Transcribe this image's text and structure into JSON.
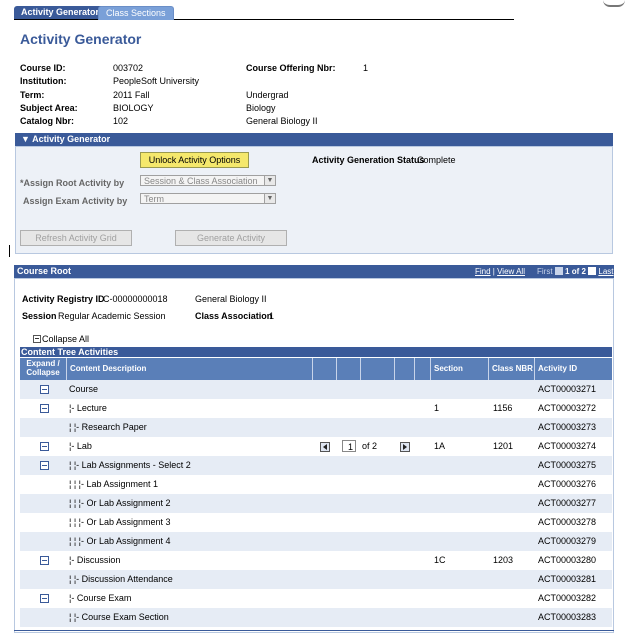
{
  "tabs": [
    {
      "label": "Activity Generator",
      "active": true
    },
    {
      "label": "Class Sections",
      "active": false
    }
  ],
  "page_title": "Activity Generator",
  "course_info": {
    "course_id_label": "Course ID:",
    "course_id": "003702",
    "offering_label": "Course Offering Nbr:",
    "offering": "1",
    "institution_label": "Institution:",
    "institution": "PeopleSoft University",
    "term_label": "Term:",
    "term": "2011 Fall",
    "career": "Undergrad",
    "subject_label": "Subject Area:",
    "subject": "BIOLOGY",
    "subject_desc": "Biology",
    "catalog_label": "Catalog Nbr:",
    "catalog": "102",
    "catalog_desc": "General Biology II"
  },
  "activity_generator": {
    "header": "▼ Activity Generator",
    "unlock_button": "Unlock Activity Options",
    "status_label": "Activity Generation Status",
    "status_value": "Complete",
    "assign_root_label": "*Assign Root Activity by",
    "assign_root_value": "Session & Class Association",
    "assign_exam_label": "Assign Exam Activity by",
    "assign_exam_value": "Term",
    "refresh_button": "Refresh Activity Grid",
    "generate_button": "Generate Activity"
  },
  "course_root": {
    "header": "Course Root",
    "find": "Find",
    "sep": "|",
    "view_all": "View All",
    "first": "First",
    "count": "1 of 2",
    "last": "Last",
    "registry_label": "Activity Registry ID",
    "registry_id": "C-00000000018",
    "registry_desc": "General Biology II",
    "session_label": "Session",
    "session_value": "Regular Academic Session",
    "class_assoc_label": "Class Association",
    "class_assoc_value": "1",
    "collapse_all": "Collapse All"
  },
  "grid": {
    "title": "Content Tree Activities",
    "columns": {
      "expand": "Expand / Collapse",
      "desc": "Content Description",
      "section": "Section",
      "class_nbr": "Class NBR",
      "activity_id": "Activity ID"
    },
    "rows": [
      {
        "minus": true,
        "desc": "Course",
        "section": "",
        "class_nbr": "",
        "activity_id": "ACT00003271"
      },
      {
        "minus": true,
        "desc": "¦- Lecture",
        "section": "1",
        "class_nbr": "1156",
        "activity_id": "ACT00003272"
      },
      {
        "minus": false,
        "desc": "¦ ¦- Research Paper",
        "section": "",
        "class_nbr": "",
        "activity_id": "ACT00003273"
      },
      {
        "minus": true,
        "desc": "¦- Lab",
        "section": "1A",
        "class_nbr": "1201",
        "activity_id": "ACT00003274",
        "pager": {
          "value": "1",
          "of": "of 2"
        }
      },
      {
        "minus": true,
        "desc": "¦ ¦- Lab Assignments - Select 2",
        "section": "",
        "class_nbr": "",
        "activity_id": "ACT00003275"
      },
      {
        "minus": false,
        "desc": "¦ ¦ ¦- Lab Assignment 1",
        "section": "",
        "class_nbr": "",
        "activity_id": "ACT00003276"
      },
      {
        "minus": false,
        "desc": "¦ ¦ ¦- Or Lab Assignment 2",
        "section": "",
        "class_nbr": "",
        "activity_id": "ACT00003277"
      },
      {
        "minus": false,
        "desc": "¦ ¦ ¦- Or Lab Assignment 3",
        "section": "",
        "class_nbr": "",
        "activity_id": "ACT00003278"
      },
      {
        "minus": false,
        "desc": "¦ ¦ ¦- Or Lab Assignment 4",
        "section": "",
        "class_nbr": "",
        "activity_id": "ACT00003279"
      },
      {
        "minus": true,
        "desc": "¦- Discussion",
        "section": "1C",
        "class_nbr": "1203",
        "activity_id": "ACT00003280"
      },
      {
        "minus": false,
        "desc": "¦ ¦- Discussion Attendance",
        "section": "",
        "class_nbr": "",
        "activity_id": "ACT00003281"
      },
      {
        "minus": true,
        "desc": "¦- Course Exam",
        "section": "",
        "class_nbr": "",
        "activity_id": "ACT00003282"
      },
      {
        "minus": false,
        "desc": "¦ ¦- Course Exam Section",
        "section": "",
        "class_nbr": "",
        "activity_id": "ACT00003283"
      }
    ]
  },
  "colors": {
    "brand": "#3a5a99",
    "header_blue": "#5a7fb8",
    "button_yellow": "#f5e86c"
  }
}
